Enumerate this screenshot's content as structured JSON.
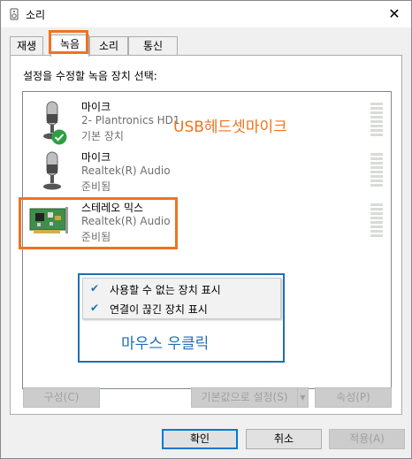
{
  "window": {
    "title": "소리"
  },
  "tabs": [
    "재생",
    "녹음",
    "소리",
    "통신"
  ],
  "instruction": "설정을 수정할 녹음 장치 선택:",
  "devices": [
    {
      "name": "마이크",
      "sub": "2- Plantronics HD1",
      "status": "기본 장치",
      "icon": "headset-mic-icon",
      "default": true
    },
    {
      "name": "마이크",
      "sub": "Realtek(R) Audio",
      "status": "준비됨",
      "icon": "microphone-icon",
      "default": false
    },
    {
      "name": "스테레오 믹스",
      "sub": "Realtek(R) Audio",
      "status": "준비됨",
      "icon": "sound-card-icon",
      "default": false
    }
  ],
  "context_menu": [
    {
      "label": "사용할 수 없는 장치 표시",
      "checked": true
    },
    {
      "label": "연결이 끊긴 장치 표시",
      "checked": true
    }
  ],
  "annotations": {
    "usb_headset": "USB헤드셋마이크",
    "right_click": "마우스 우클릭"
  },
  "panel_buttons": {
    "configure": "구성(C)",
    "set_default": "기본값으로 설정(S)",
    "properties": "속성(P)"
  },
  "dialog_buttons": {
    "ok": "확인",
    "cancel": "취소",
    "apply": "적용(A)"
  },
  "colors": {
    "highlight_orange": "#f0731f",
    "highlight_blue": "#1f6fb6",
    "default_check_green": "#2ea043"
  }
}
